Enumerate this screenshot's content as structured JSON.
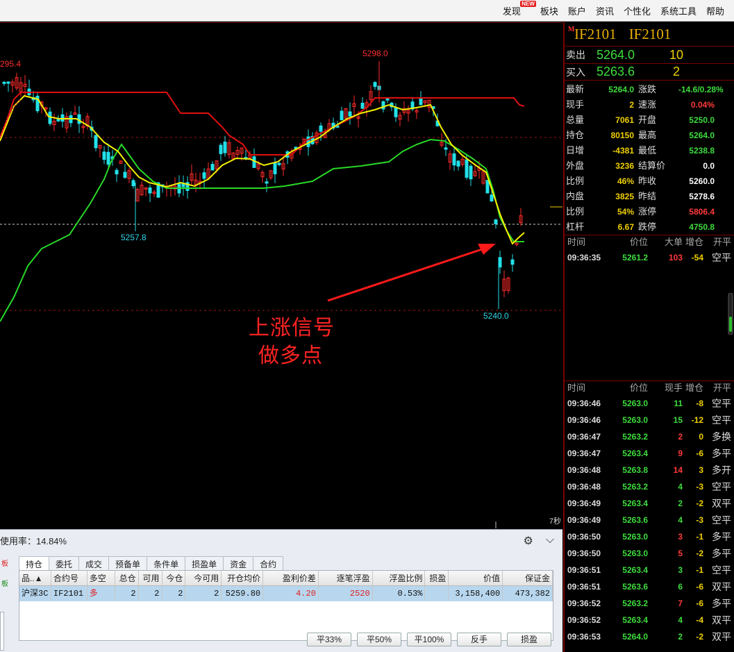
{
  "menu": {
    "items": [
      "发现",
      "板块",
      "账户",
      "资讯",
      "个性化",
      "系统工具",
      "帮助"
    ],
    "new_badge": "NEW"
  },
  "chart": {
    "labels": {
      "high_left": "295.4",
      "high_mid": "5298.0",
      "low_left": "5257.8",
      "low_right": "5240.0"
    },
    "annotation_line1": "上涨信号",
    "annotation_line2": "做多点",
    "interval": "7秒",
    "colors": {
      "up": "#ff2a2a",
      "down": "#22e0e8",
      "upper_band": "#e01010",
      "lower_band": "#28d828",
      "mid_line": "#f5f000",
      "arrow": "#ff1a1a"
    }
  },
  "quote": {
    "symbol": "IF2101",
    "symbol_name": "IF2101",
    "marker": "M",
    "sell_label": "卖出",
    "sell_price": "5264.0",
    "sell_volume": "10",
    "buy_label": "买入",
    "buy_price": "5263.6",
    "buy_volume": "2",
    "fields": [
      [
        "最新",
        "5264.0",
        "涨跌",
        "-14.6/0.28%"
      ],
      [
        "现手",
        "2",
        "速涨",
        "0.04%"
      ],
      [
        "总量",
        "7061",
        "开盘",
        "5250.0"
      ],
      [
        "持仓",
        "80150",
        "最高",
        "5264.0"
      ],
      [
        "日增",
        "-4381",
        "最低",
        "5238.8"
      ],
      [
        "外盘",
        "3236",
        "结算价",
        "0.0"
      ],
      [
        "比例",
        "46%",
        "昨收",
        "5260.0"
      ],
      [
        "内盘",
        "3825",
        "昨结",
        "5278.6"
      ],
      [
        "比例",
        "54%",
        "涨停",
        "5806.4"
      ],
      [
        "杠杆",
        "6.67",
        "跌停",
        "4750.8"
      ]
    ],
    "big_head": [
      "时间",
      "价位",
      "大单",
      "增仓",
      "开平"
    ],
    "big_rows": [
      [
        "09:36:35",
        "5261.2",
        "103",
        "-54",
        "空平"
      ]
    ],
    "tick_head": [
      "时间",
      "价位",
      "现手",
      "增仓",
      "开平"
    ],
    "ticks": [
      [
        "09:36:46",
        "5263.0",
        "11",
        "-8",
        "空平"
      ],
      [
        "09:36:46",
        "5263.0",
        "15",
        "-12",
        "空平"
      ],
      [
        "09:36:47",
        "5263.2",
        "2",
        "0",
        "多换"
      ],
      [
        "09:36:47",
        "5263.4",
        "9",
        "-6",
        "多平"
      ],
      [
        "09:36:48",
        "5263.8",
        "14",
        "3",
        "多开"
      ],
      [
        "09:36:48",
        "5263.2",
        "4",
        "-3",
        "空平"
      ],
      [
        "09:36:49",
        "5263.4",
        "2",
        "-2",
        "双平"
      ],
      [
        "09:36:49",
        "5263.6",
        "4",
        "-3",
        "空平"
      ],
      [
        "09:36:50",
        "5263.0",
        "3",
        "-1",
        "多平"
      ],
      [
        "09:36:50",
        "5263.0",
        "5",
        "-2",
        "多平"
      ],
      [
        "09:36:51",
        "5263.4",
        "3",
        "-1",
        "空平"
      ],
      [
        "09:36:51",
        "5263.6",
        "6",
        "-6",
        "双平"
      ],
      [
        "09:36:52",
        "5263.2",
        "7",
        "-6",
        "多平"
      ],
      [
        "09:36:52",
        "5263.4",
        "4",
        "-4",
        "双平"
      ],
      [
        "09:36:53",
        "5264.0",
        "2",
        "-2",
        "双平"
      ]
    ]
  },
  "trade": {
    "usage_text": "使用率：14.84%",
    "side_tabs": [
      "板",
      "板"
    ],
    "tabs": [
      "持仓",
      "委托",
      "成交",
      "预备单",
      "条件单",
      "损盈单",
      "资金",
      "合约"
    ],
    "columns": [
      "品..▲",
      "合约号",
      "多空",
      "总仓",
      "可用",
      "今仓",
      "今可用",
      "开仓均价",
      "盈利价差",
      "逐笔浮盈",
      "浮盈比例",
      "损盈",
      "价值",
      "保证金"
    ],
    "row": [
      "沪深3C",
      "IF2101",
      "多",
      "2",
      "2",
      "2",
      "2",
      "5259.80",
      "4.20",
      "2520",
      "0.53%",
      "",
      "3,158,400",
      "473,382"
    ],
    "buttons": [
      "平33%",
      "平50%",
      "平100%",
      "反手",
      "损盈"
    ]
  }
}
